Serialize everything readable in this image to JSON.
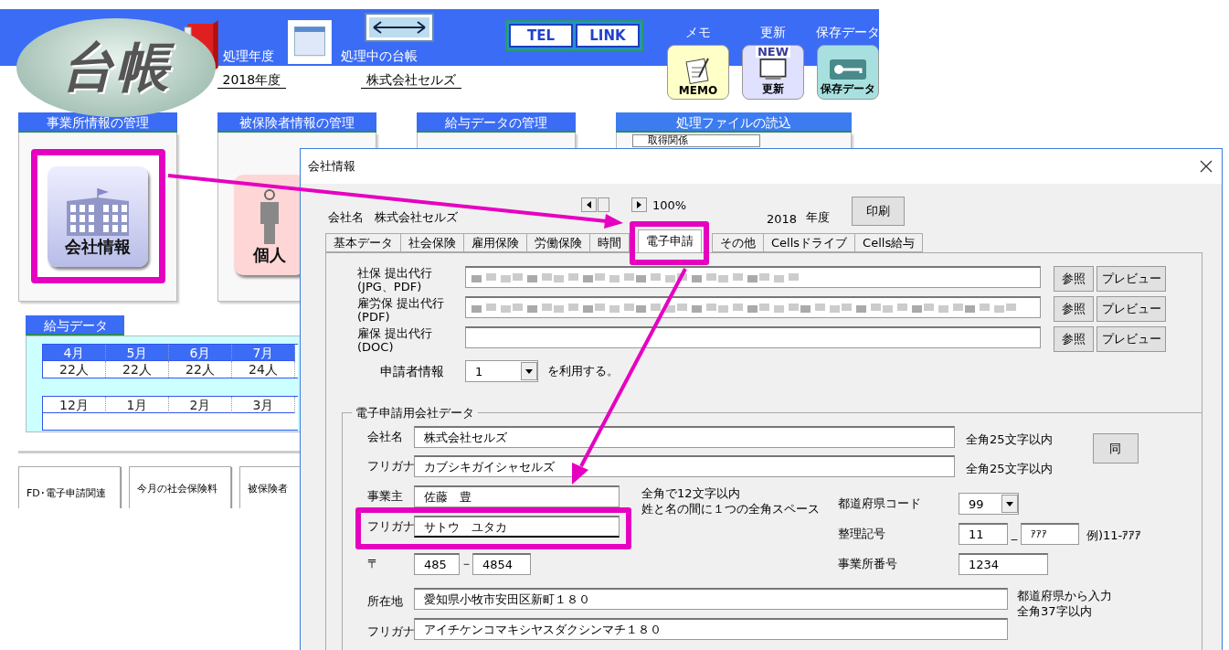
{
  "header": {
    "logo": "台帳",
    "year_label": "処理年度",
    "year": "2018年度",
    "ledger_label": "処理中の台帳",
    "ledger": "株式会社セルズ",
    "link_buttons": [
      "TEL",
      "LINK"
    ],
    "tools": [
      {
        "label": "メモ",
        "kind": "memo",
        "icon_text": "MEMO"
      },
      {
        "label": "更新",
        "kind": "update",
        "icon_text": "更新",
        "badge": "NEW"
      },
      {
        "label": "保存データ",
        "kind": "save",
        "icon_text": "保存データ"
      }
    ]
  },
  "panels": [
    {
      "title": "事業所情報の管理",
      "kind": "building",
      "tile": "会社情報"
    },
    {
      "title": "被保険者情報の管理",
      "kind": "person",
      "tile": "個人"
    },
    {
      "title": "給与データの管理",
      "kind": "empty"
    },
    {
      "title": "処理ファイルの読込",
      "kind": "select",
      "tile": "取得関係"
    }
  ],
  "salary": {
    "title": "給与データ",
    "tables": [
      {
        "highlighted": true,
        "months": [
          "4月",
          "5月",
          "6月",
          "7月"
        ],
        "counts": [
          "22人",
          "22人",
          "22人",
          "24人"
        ]
      },
      {
        "highlighted": false,
        "months": [
          "12月",
          "1月",
          "2月",
          "3月"
        ]
      }
    ]
  },
  "shortcuts": [
    "FD･電子申請関連",
    "今月の社会保険料",
    "被保険者"
  ],
  "dialog": {
    "title": "会社情報",
    "company_label": "会社名",
    "company": "株式会社セルズ",
    "zoom": "100%",
    "year": "2018",
    "year_unit": "年度",
    "print": "印刷",
    "tabs": [
      {
        "label": "基本データ",
        "selected": false
      },
      {
        "label": "社会保険",
        "selected": false
      },
      {
        "label": "雇用保険",
        "selected": false
      },
      {
        "label": "労働保険",
        "selected": false
      },
      {
        "label": "時間",
        "selected": false
      },
      {
        "label": "電子申請",
        "selected": true
      },
      {
        "label": "その他",
        "selected": false
      },
      {
        "label": "Cellsドライブ",
        "selected": false
      },
      {
        "label": "Cells給与",
        "selected": false
      }
    ],
    "submission_rows": [
      {
        "label": [
          "社保 提出代行",
          "(JPG、PDF)"
        ],
        "redacted": true,
        "buttons": [
          "参照",
          "プレビュー"
        ]
      },
      {
        "label": [
          "雇労保 提出代行",
          "(PDF)"
        ],
        "redacted": true,
        "buttons": [
          "参照",
          "プレビュー"
        ]
      },
      {
        "label": [
          "雇保 提出代行",
          "(DOC)"
        ],
        "redacted": false,
        "buttons": [
          "参照",
          "プレビュー"
        ]
      }
    ],
    "applicant": {
      "label": "申請者情報",
      "value": "1",
      "suffix": "を利用する。"
    },
    "group": {
      "title": "電子申請用会社データ",
      "company_name": {
        "label": "会社名",
        "value": "株式会社セルズ",
        "note": "全角25文字以内"
      },
      "company_kana": {
        "label": "フリガナ",
        "value": "カブシキガイシャセルズ",
        "note": "全角25文字以内"
      },
      "same_button": "同",
      "owner": {
        "label": "事業主",
        "value": "佐藤　豊",
        "notes": [
          "全角で12文字以内",
          "姓と名の間に１つの全角スペース"
        ]
      },
      "owner_kana": {
        "label": "フリガナ",
        "value": "サトウ　ユタカ"
      },
      "postal": {
        "label": "〒",
        "first": "485",
        "separator": "－",
        "second": "4854"
      },
      "address": {
        "label": "所在地",
        "value": "愛知県小牧市安田区新町１８０",
        "notes": [
          "都道府県から入力",
          "全角37字以内"
        ]
      },
      "address_kana": {
        "label": "フリガナ",
        "value": "アイチケンコマキシヤスダクシンマチ１８０"
      },
      "prefecture_code": {
        "label": "都道府県コード",
        "value": "99"
      },
      "reference": {
        "label": "整理記号",
        "first": "11",
        "separator": "_",
        "second": "ｱｱｱ",
        "example": "例)11-ｱｱｱ"
      },
      "office_number": {
        "label": "事業所番号",
        "value": "1234"
      }
    }
  }
}
